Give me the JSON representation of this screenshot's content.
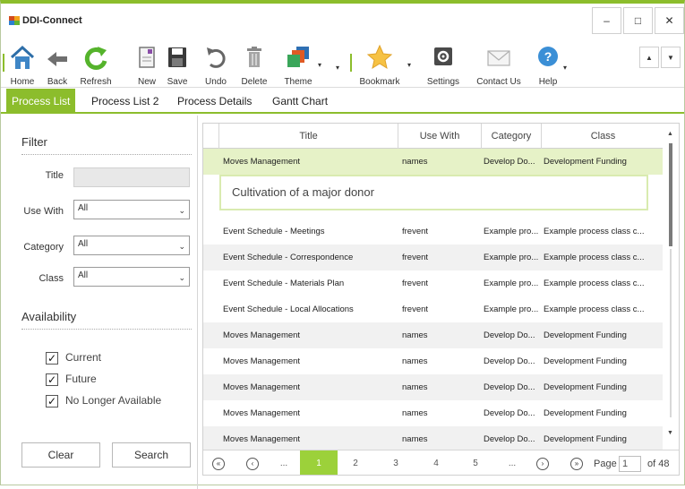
{
  "app": {
    "title": "DDI-Connect"
  },
  "window_controls": {
    "minimize": "–",
    "maximize": "□",
    "close": "✕"
  },
  "ribbon": {
    "buttons": [
      {
        "id": "home",
        "label": "Home",
        "icon": "home-icon"
      },
      {
        "id": "back",
        "label": "Back",
        "icon": "back-arrow-icon"
      },
      {
        "id": "refresh",
        "label": "Refresh",
        "icon": "refresh-icon"
      },
      {
        "id": "new",
        "label": "New",
        "icon": "new-document-icon"
      },
      {
        "id": "save",
        "label": "Save",
        "icon": "save-icon"
      },
      {
        "id": "undo",
        "label": "Undo",
        "icon": "undo-icon"
      },
      {
        "id": "delete",
        "label": "Delete",
        "icon": "trash-icon"
      },
      {
        "id": "theme",
        "label": "Theme",
        "icon": "theme-icon"
      },
      {
        "id": "bookmark",
        "label": "Bookmark",
        "icon": "star-icon"
      },
      {
        "id": "settings",
        "label": "Settings",
        "icon": "settings-icon"
      },
      {
        "id": "contact",
        "label": "Contact Us",
        "icon": "envelope-icon"
      },
      {
        "id": "help",
        "label": "Help",
        "icon": "help-icon"
      }
    ],
    "dropdown_caret": "▾",
    "scroll_up": "▲",
    "scroll_down": "▼"
  },
  "tabs": [
    {
      "label": "Process List",
      "active": true
    },
    {
      "label": "Process List 2",
      "active": false
    },
    {
      "label": "Process Details",
      "active": false
    },
    {
      "label": "Gantt Chart",
      "active": false
    }
  ],
  "filter": {
    "heading": "Filter",
    "title_label": "Title",
    "title_value": "",
    "use_with_label": "Use With",
    "use_with_value": "All",
    "category_label": "Category",
    "category_value": "All",
    "class_label": "Class",
    "class_value": "All",
    "availability_heading": "Availability",
    "checkboxes": [
      {
        "label": "Current",
        "checked": true
      },
      {
        "label": "Future",
        "checked": true
      },
      {
        "label": "No Longer Available",
        "checked": true
      }
    ],
    "check_mark": "✓",
    "clear_label": "Clear",
    "search_label": "Search"
  },
  "grid": {
    "columns": [
      "Title",
      "Use With",
      "Category",
      "Class"
    ],
    "selected_detail": "Cultivation of a major donor",
    "rows": [
      {
        "title": "Moves Management",
        "use_with": "names",
        "category": "Develop  Do...",
        "class": "Development Funding",
        "selected": true
      },
      {
        "title": "Event Schedule - Meetings",
        "use_with": "frevent",
        "category": "Example pro...",
        "class": "Example process class c..."
      },
      {
        "title": "Event Schedule - Correspondence",
        "use_with": "frevent",
        "category": "Example pro...",
        "class": "Example process class c..."
      },
      {
        "title": "Event Schedule - Materials Plan",
        "use_with": "frevent",
        "category": "Example pro...",
        "class": "Example process class c..."
      },
      {
        "title": "Event Schedule - Local Allocations",
        "use_with": "frevent",
        "category": "Example pro...",
        "class": "Example process class c..."
      },
      {
        "title": "Moves Management",
        "use_with": "names",
        "category": "Develop  Do...",
        "class": "Development Funding"
      },
      {
        "title": "Moves Management",
        "use_with": "names",
        "category": "Develop  Do...",
        "class": "Development Funding"
      },
      {
        "title": "Moves Management",
        "use_with": "names",
        "category": "Develop  Do...",
        "class": "Development Funding"
      },
      {
        "title": "Moves Management",
        "use_with": "names",
        "category": "Develop  Do...",
        "class": "Development Funding"
      },
      {
        "title": "Moves Management",
        "use_with": "names",
        "category": "Develop  Do...",
        "class": "Development Funding"
      }
    ]
  },
  "pager": {
    "first": "«",
    "prev": "‹",
    "next": "›",
    "last": "»",
    "ellipsis": "...",
    "pages": [
      "1",
      "2",
      "3",
      "4",
      "5"
    ],
    "current_page": "1",
    "page_label": "Page",
    "page_value": "1",
    "of_label": "of 48"
  },
  "colors": {
    "accent": "#8cbd2c",
    "selected_row": "#e6f2c7",
    "active_page": "#9cd13a"
  }
}
